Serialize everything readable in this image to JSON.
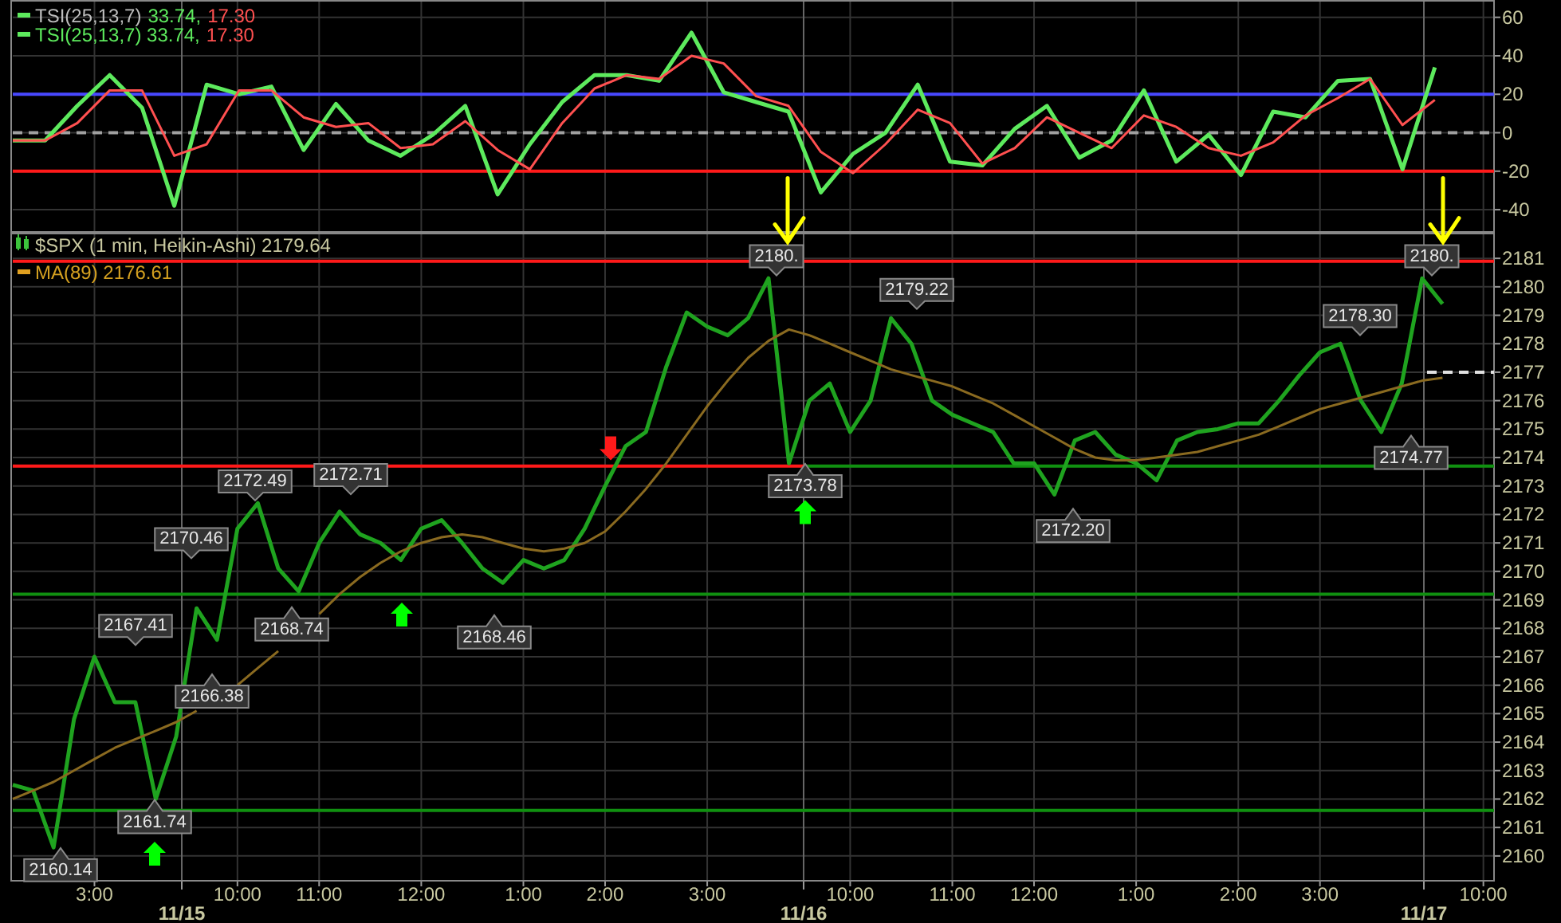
{
  "tsi_panel": {
    "legend": [
      {
        "kind": "line",
        "parts": [
          {
            "text": "TSI(25,13,7)",
            "color": "#bdbdbd"
          },
          {
            "text": "33.74,",
            "color": "#5dea5d"
          },
          {
            "text": "17.30",
            "color": "#ff5050"
          }
        ]
      },
      {
        "kind": "line",
        "parts": [
          {
            "text": "TSI(25,13,7) 33.74,",
            "color": "#5dea5d"
          },
          {
            "text": "17.30",
            "color": "#ff5050"
          }
        ]
      }
    ],
    "chart_data": {
      "type": "line",
      "grid": true,
      "ylim": [
        -52,
        69
      ],
      "yticks": [
        -40,
        -20,
        0,
        20,
        40,
        60
      ],
      "series": [
        {
          "color": "#5dea5d",
          "values": [
            -4,
            -4,
            14,
            30,
            13,
            -38,
            25,
            20,
            24,
            -9,
            15,
            -4,
            -12,
            -1,
            14,
            -32,
            -6,
            16,
            30,
            30,
            27,
            52,
            21,
            16,
            11,
            -31,
            -11,
            0,
            25,
            -15,
            -17,
            2,
            14,
            -13,
            -4,
            22,
            -15,
            -1,
            -22,
            11,
            8,
            27,
            28,
            -19,
            34
          ]
        },
        {
          "color": "#ff5050",
          "values": [
            -4,
            -4,
            5,
            22,
            22,
            -12,
            -6,
            22,
            22,
            8,
            3,
            5,
            -8,
            -6,
            6,
            -9,
            -19,
            5,
            23,
            30,
            28,
            40,
            36,
            19,
            14,
            -10,
            -21,
            -6,
            12,
            5,
            -16,
            -8,
            8,
            0,
            -8,
            9,
            3,
            -8,
            -12,
            -5,
            9,
            18,
            28,
            4,
            17
          ]
        }
      ],
      "ref_lines": [
        {
          "axis": "y",
          "value": 20,
          "color": "#4848ff"
        },
        {
          "axis": "y",
          "value": 0,
          "color": "#a0a0a0"
        },
        {
          "axis": "y",
          "value": -20,
          "color": "#ff1a1a"
        }
      ]
    }
  },
  "price_panel": {
    "legend": [
      {
        "kind": "candles",
        "text": "$SPX (1 min, Heikin-Ashi) 2179.64"
      },
      {
        "kind": "line",
        "text": "MA(89) 2176.61"
      }
    ],
    "chart_data": {
      "type": "line",
      "grid": true,
      "ylim": [
        2159.1,
        2181.9
      ],
      "yticks": [
        2160,
        2161,
        2162,
        2163,
        2164,
        2165,
        2166,
        2167,
        2168,
        2169,
        2170,
        2171,
        2172,
        2173,
        2174,
        2175,
        2176,
        2177,
        2178,
        2179,
        2180,
        2181
      ],
      "categories": [
        null,
        null,
        null,
        null,
        "3:00",
        null,
        null,
        null,
        null,
        null,
        null,
        "10:00",
        null,
        null,
        null,
        "11:00",
        null,
        null,
        null,
        null,
        "12:00",
        null,
        null,
        null,
        null,
        "1:00",
        null,
        null,
        null,
        "2:00",
        null,
        null,
        null,
        null,
        "3:00",
        null,
        null,
        null,
        null,
        null,
        null,
        "10:00",
        null,
        null,
        null,
        null,
        "11:00",
        null,
        null,
        null,
        "12:00",
        null,
        null,
        null,
        null,
        "1:00",
        null,
        null,
        null,
        null,
        "2:00",
        null,
        null,
        null,
        "3:00",
        null,
        null,
        null,
        null,
        null,
        null,
        null,
        "10:00"
      ],
      "series": [
        {
          "color": "#1fa31f",
          "values": [
            2162.5,
            2162.3,
            2160.3,
            2164.8,
            2167,
            2165.4,
            2165.4,
            2162,
            2164.2,
            2168.7,
            2167.6,
            2171.5,
            2172.4,
            2170.1,
            2169.3,
            2171,
            2172.1,
            2171.3,
            2171,
            2170.4,
            2171.5,
            2171.8,
            2171,
            2170.1,
            2169.6,
            2170.4,
            2170.1,
            2170.4,
            2171.5,
            2173,
            2174.4,
            2174.9,
            2177.2,
            2179.1,
            2178.6,
            2178.3,
            2178.9,
            2180.3,
            2173.8,
            2176,
            2176.6,
            2174.9,
            2176,
            2178.9,
            2178,
            2176,
            2175.5,
            2175.2,
            2174.9,
            2173.8,
            2173.8,
            2172.7,
            2174.6,
            2174.9,
            2174.1,
            2173.8,
            2173.2,
            2174.6,
            2174.9,
            2175,
            2175.2,
            2175.2,
            2176,
            2176.9,
            2177.7,
            2178,
            2176,
            2174.9,
            2176.6,
            2180.3,
            2179.4,
            null,
            null
          ]
        },
        {
          "color": "#8a6a20",
          "values": [
            2162,
            2162.3,
            2162.6,
            2163,
            2163.4,
            2163.8,
            2164.1,
            2164.4,
            2164.7,
            2165.1,
            null,
            2166,
            2166.6,
            2167.2,
            null,
            2168.5,
            2169.2,
            2169.8,
            2170.3,
            2170.7,
            2171,
            2171.2,
            2171.3,
            2171.2,
            2171,
            2170.8,
            2170.7,
            2170.8,
            2171,
            2171.4,
            2172.1,
            2172.9,
            2173.8,
            2174.8,
            2175.8,
            2176.7,
            2177.5,
            2178.1,
            2178.5,
            2178.3,
            2178,
            2177.7,
            2177.4,
            2177.1,
            2176.9,
            2176.7,
            2176.5,
            2176.2,
            2175.9,
            2175.5,
            2175.1,
            2174.7,
            2174.3,
            2174,
            2173.9,
            2173.9,
            2174,
            2174.1,
            2174.2,
            2174.4,
            2174.6,
            2174.8,
            2175.1,
            2175.4,
            2175.7,
            2175.9,
            2176.1,
            2176.3,
            2176.5,
            2176.7,
            2176.8,
            null,
            null
          ]
        }
      ],
      "ref_lines": [
        {
          "axis": "y",
          "value": 2180.9,
          "color": "#ff1a1a"
        },
        {
          "axis": "y",
          "value": 2173.7,
          "color": "#ff1a1a"
        },
        {
          "axis": "y",
          "value": 2173.7,
          "color": "#109010"
        },
        {
          "axis": "y",
          "value": 2169.2,
          "color": "#109010"
        },
        {
          "axis": "y",
          "value": 2161.6,
          "color": "#109010"
        }
      ],
      "annotations": [
        "2180.",
        "2180.",
        "2179.22",
        "2178.30",
        "2172.49",
        "2172.71",
        "2173.78",
        "2174.77",
        "2170.46",
        "2172.20",
        "2167.41",
        "2168.74",
        "2168.46",
        "2166.38",
        "2161.74",
        "2160.14"
      ]
    }
  },
  "time_axis": {
    "dates": [
      "11/15",
      "11/16",
      "11/17"
    ]
  }
}
